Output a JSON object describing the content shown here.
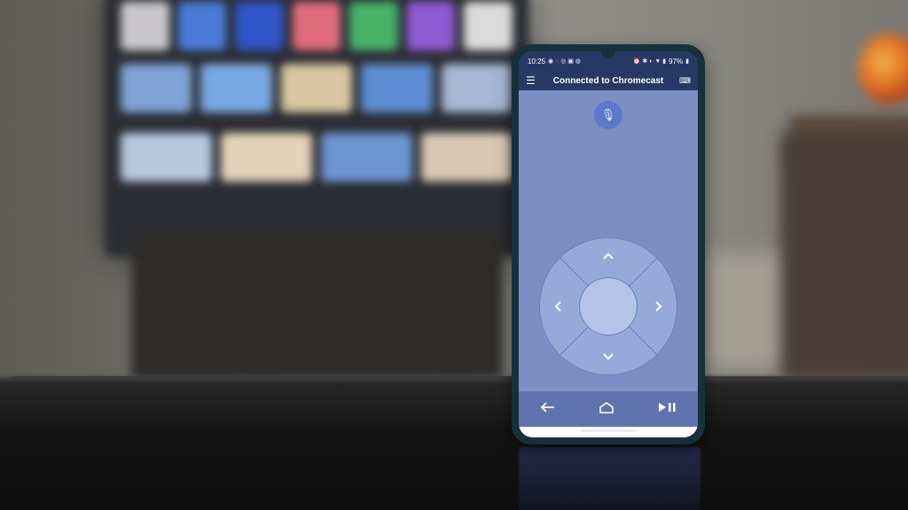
{
  "status_bar": {
    "time": "10:25",
    "battery": "97%"
  },
  "app_bar": {
    "title": "Connected to Chromecast"
  },
  "icons": {
    "menu": "hamburger-menu-icon",
    "keyboard": "keyboard-icon",
    "microphone": "microphone-icon",
    "back": "back-arrow-icon",
    "home": "home-icon",
    "play_pause": "play-pause-icon"
  },
  "dpad": {
    "up": "^",
    "down": "v",
    "left": "<",
    "right": ">"
  },
  "colors": {
    "app_bar": "#263964",
    "screen_bg": "#7b8fc5",
    "dpad": "#95aad9",
    "dpad_center": "#b5c3e8",
    "mic": "#5d78c6",
    "nav_bar": "#5f74af"
  }
}
